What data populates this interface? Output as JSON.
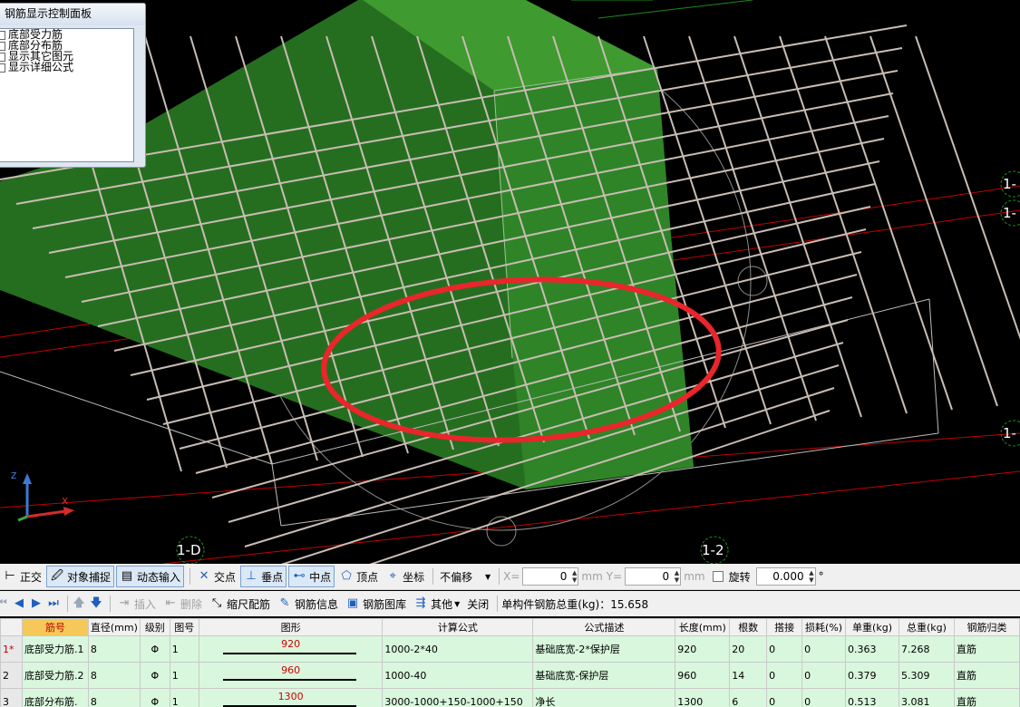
{
  "panel": {
    "title": "钢筋显示控制面板",
    "items": [
      "底部受力筋",
      "底部分布筋",
      "显示其它图元",
      "显示详细公式"
    ]
  },
  "axis_labels": {
    "bottom_left": "1-D",
    "bottom_right": "1-2",
    "right_1": "1-",
    "right_2": "1-",
    "right_3": "1-"
  },
  "toolbar1": {
    "ortho": "正交",
    "snap": "对象捕捉",
    "dynamic_input": "动态输入",
    "intersection": "交点",
    "perpendicular": "垂点",
    "midpoint": "中点",
    "vertex": "顶点",
    "coordinate": "坐标",
    "offset_select": "不偏移",
    "x_label": "X=",
    "x_value": "0",
    "y_label": "Y=",
    "y_value": "0",
    "unit": "mm",
    "rotate": "旋转",
    "rotate_value": "0.000",
    "degree": "°"
  },
  "toolbar2": {
    "insert": "插入",
    "delete": "删除",
    "scale_rebar": "缩尺配筋",
    "rebar_info": "钢筋信息",
    "rebar_library": "钢筋图库",
    "other": "其他",
    "close": "关闭",
    "total_weight": "单构件钢筋总重(kg)：15.658"
  },
  "table": {
    "headers": [
      "筋号",
      "直径(mm)",
      "级别",
      "图号",
      "图形",
      "计算公式",
      "公式描述",
      "长度(mm)",
      "根数",
      "搭接",
      "损耗(%)",
      "单重(kg)",
      "总重(kg)",
      "钢筋归类"
    ],
    "rows": [
      {
        "idx": "1*",
        "name": "底部受力筋.1",
        "dia": "8",
        "grade": "Φ",
        "fig": "1",
        "shape": "920",
        "formula": "1000-2*40",
        "desc": "基础底宽-2*保护层",
        "length": "920",
        "count": "20",
        "lap": "0",
        "loss": "0",
        "unit_w": "0.363",
        "total_w": "7.268",
        "cat": "直筋"
      },
      {
        "idx": "2",
        "name": "底部受力筋.2",
        "dia": "8",
        "grade": "Φ",
        "fig": "1",
        "shape": "960",
        "formula": "1000-40",
        "desc": "基础底宽-保护层",
        "length": "960",
        "count": "14",
        "lap": "0",
        "loss": "0",
        "unit_w": "0.379",
        "total_w": "5.309",
        "cat": "直筋"
      },
      {
        "idx": "3",
        "name": "底部分布筋.",
        "dia": "8",
        "grade": "Φ",
        "fig": "1",
        "shape": "1300",
        "formula": "3000-1000+150-1000+150",
        "desc": "净长",
        "length": "1300",
        "count": "6",
        "lap": "0",
        "loss": "0",
        "unit_w": "0.513",
        "total_w": "3.081",
        "cat": "直筋"
      }
    ]
  },
  "colors": {
    "viewport_bg": "#000000",
    "footing_green": "#2e7a26",
    "rebar": "#c8bdb4",
    "highlight_ellipse": "#e8262b",
    "axis_red": "#c40000",
    "row_bg": "#d9f7dd",
    "header_selected": "#f6c85a"
  },
  "icons": [
    "snap-icon",
    "dynamic-input-icon",
    "intersection-icon",
    "perpendicular-icon",
    "midpoint-icon",
    "vertex-icon",
    "coordinate-icon",
    "first-icon",
    "prev-icon",
    "next-icon",
    "last-icon",
    "up-icon",
    "down-icon",
    "insert-icon",
    "delete-icon",
    "scale-rebar-icon",
    "rebar-info-icon",
    "rebar-library-icon",
    "other-icon",
    "axis-triad-icon"
  ]
}
